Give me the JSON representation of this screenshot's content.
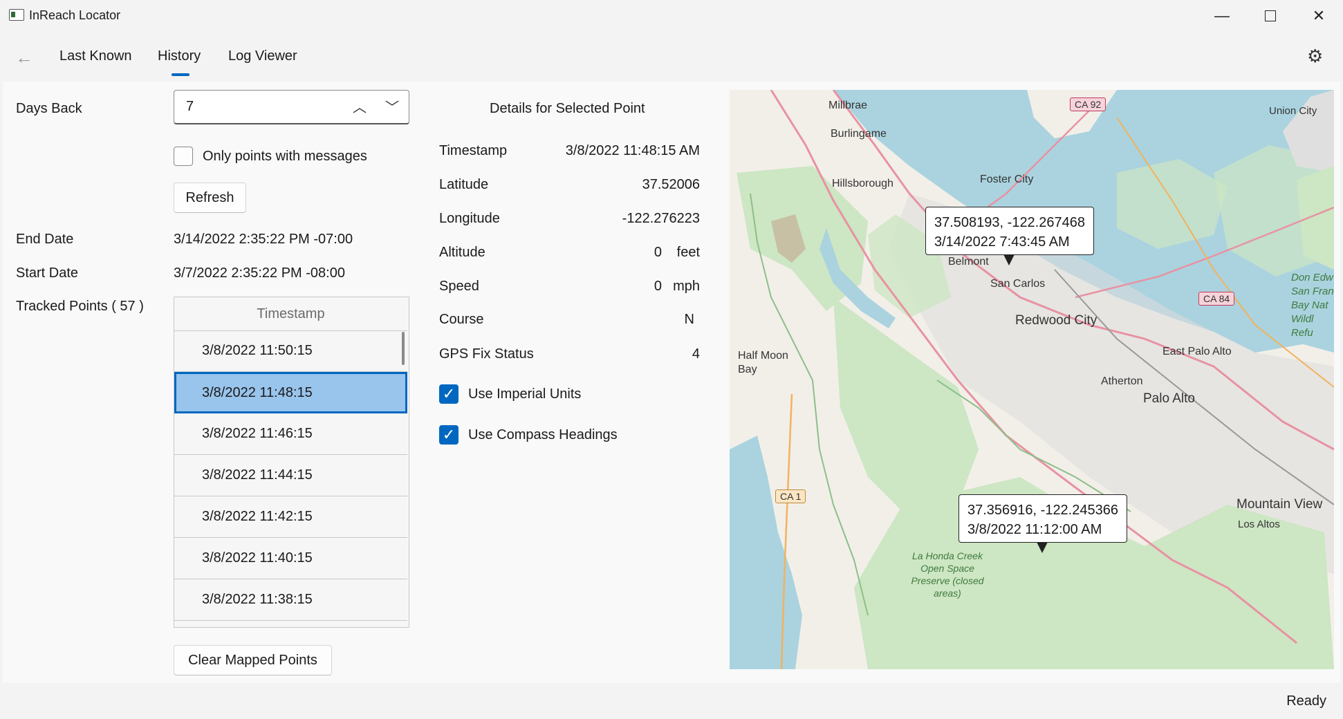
{
  "window": {
    "title": "InReach Locator"
  },
  "nav": {
    "tabs": [
      "Last Known",
      "History",
      "Log Viewer"
    ],
    "active_tab": "History"
  },
  "form": {
    "days_back_label": "Days Back",
    "days_back_value": "7",
    "only_messages_label": "Only points with messages",
    "only_messages_checked": false,
    "refresh_label": "Refresh",
    "end_date_label": "End Date",
    "end_date_value": "3/14/2022 2:35:22 PM -07:00",
    "start_date_label": "Start Date",
    "start_date_value": "3/7/2022 2:35:22 PM -08:00",
    "tracked_points_label": "Tracked Points ( 57 )",
    "clear_label": "Clear Mapped Points"
  },
  "points_list": {
    "header": "Timestamp",
    "rows": [
      "3/8/2022 11:50:15",
      "3/8/2022 11:48:15",
      "3/8/2022 11:46:15",
      "3/8/2022 11:44:15",
      "3/8/2022 11:42:15",
      "3/8/2022 11:40:15",
      "3/8/2022 11:38:15"
    ],
    "selected_index": 1
  },
  "details": {
    "title": "Details for Selected Point",
    "timestamp_label": "Timestamp",
    "timestamp_value": "3/8/2022 11:48:15 AM",
    "latitude_label": "Latitude",
    "latitude_value": "37.52006",
    "longitude_label": "Longitude",
    "longitude_value": "-122.276223",
    "altitude_label": "Altitude",
    "altitude_value": "0",
    "altitude_unit": "feet",
    "speed_label": "Speed",
    "speed_value": "0",
    "speed_unit": "mph",
    "course_label": "Course",
    "course_value": "N",
    "gps_label": "GPS Fix Status",
    "gps_value": "4",
    "imperial_label": "Use Imperial Units",
    "imperial_checked": true,
    "compass_label": "Use Compass Headings",
    "compass_checked": true
  },
  "map": {
    "callouts": [
      {
        "coords": "37.508193, -122.267468",
        "time": "3/14/2022 7:43:45 AM"
      },
      {
        "coords": "37.356916, -122.245366",
        "time": "3/8/2022 11:12:00 AM"
      }
    ],
    "places": [
      "Millbrae",
      "Burlingame",
      "Hillsborough",
      "Foster City",
      "Belmont",
      "San Carlos",
      "Redwood City",
      "Half Moon Bay",
      "East Palo Alto",
      "Atherton",
      "Palo Alto",
      "Mountain View",
      "Los Altos",
      "Union City"
    ],
    "shields": [
      "CA 92",
      "CA 84",
      "CA 1"
    ],
    "preserve": "La Honda Creek Open Space Preserve (closed areas)",
    "refuge": "Don Edw San Fran Bay Nat Wildl Refu",
    "colors": {
      "water": "#aad3df",
      "land": "#f2efe9",
      "park": "#cde6c3",
      "road": "#e892a2"
    }
  },
  "status": {
    "text": "Ready"
  },
  "icons": [
    "app-icon",
    "back-arrow-icon",
    "gear-icon",
    "chevron-up-icon",
    "chevron-down-icon",
    "checkmark-icon",
    "minimize-icon",
    "maximize-icon",
    "close-icon"
  ]
}
